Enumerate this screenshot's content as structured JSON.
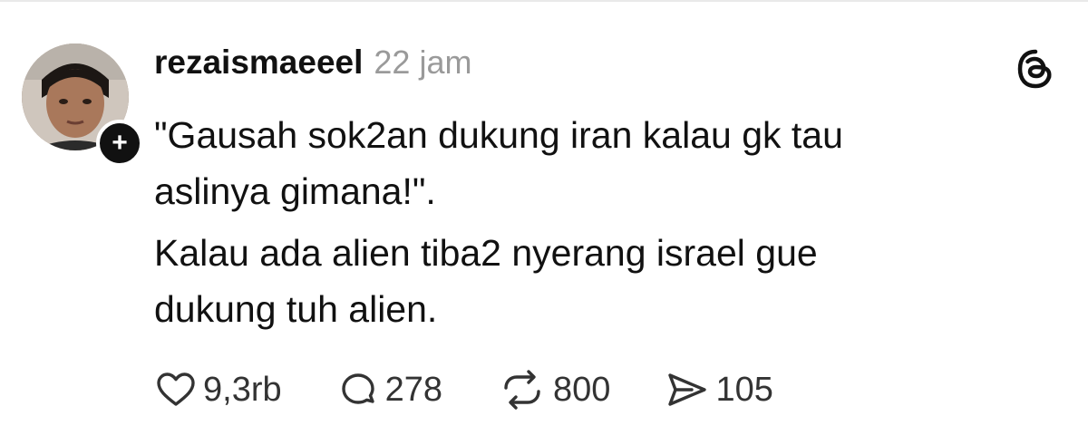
{
  "post": {
    "username": "rezaismaeeel",
    "timestamp": "22 jam",
    "follow_symbol": "+",
    "paragraphs": [
      "\"Gausah sok2an dukung iran kalau gk tau\naslinya gimana!\".",
      "Kalau ada alien tiba2 nyerang israel gue\ndukung tuh alien."
    ]
  },
  "actions": {
    "like": {
      "icon": "heart-icon",
      "count": "9,3rb"
    },
    "reply": {
      "icon": "comment-icon",
      "count": "278"
    },
    "repost": {
      "icon": "repost-icon",
      "count": "800"
    },
    "share": {
      "icon": "send-icon",
      "count": "105"
    }
  },
  "brand": {
    "icon": "threads-logo-icon"
  },
  "colors": {
    "text": "#111111",
    "muted": "#9a9a9a",
    "action_text": "#333333",
    "background": "#ffffff"
  }
}
